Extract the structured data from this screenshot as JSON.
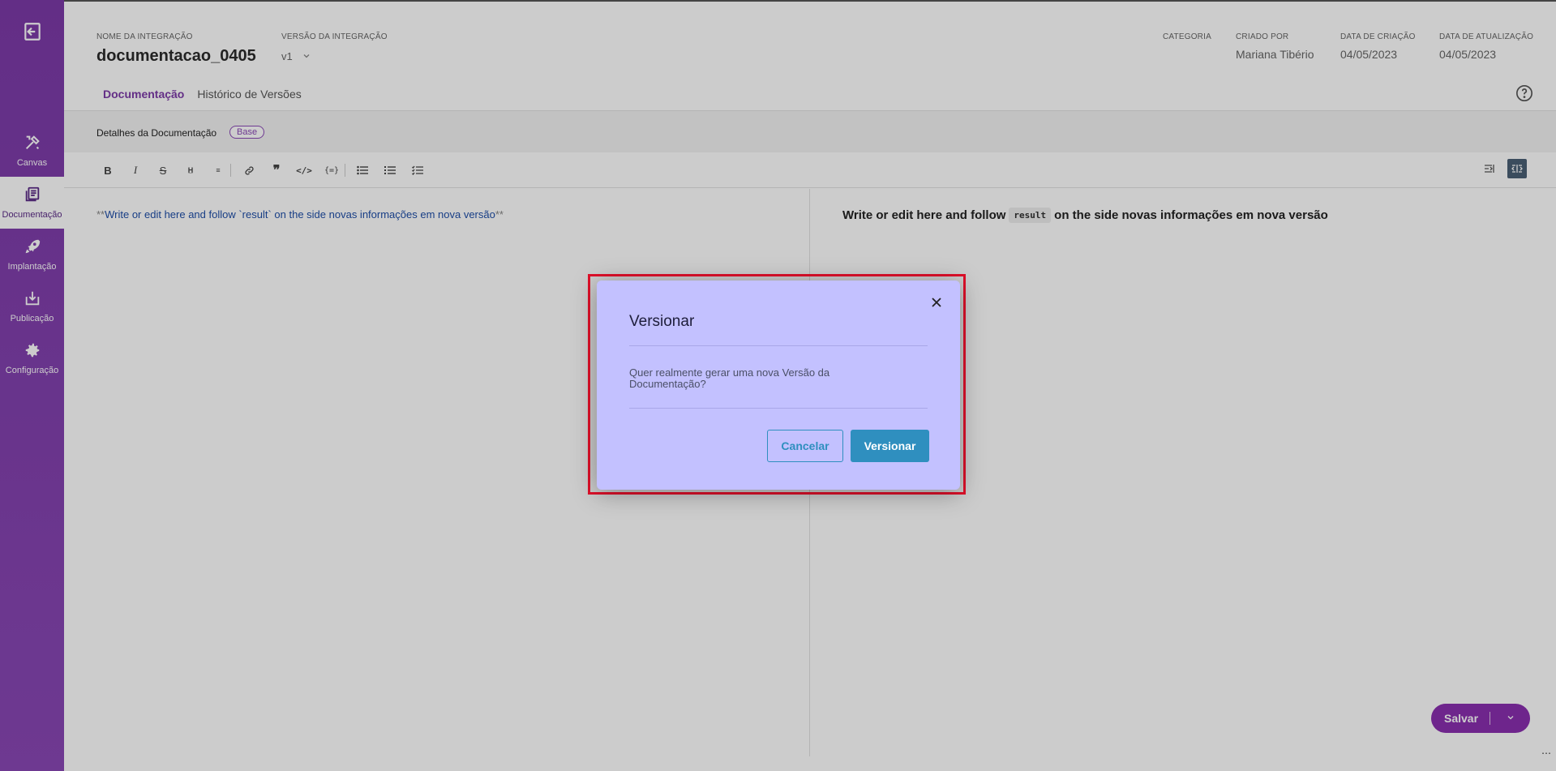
{
  "sidebar": {
    "items": [
      {
        "label": "Canvas",
        "icon": "tools-icon"
      },
      {
        "label": "Documentação",
        "icon": "document-stack-icon",
        "active": true
      },
      {
        "label": "Implantação",
        "icon": "rocket-icon"
      },
      {
        "label": "Publicação",
        "icon": "download-box-icon"
      },
      {
        "label": "Configuração",
        "icon": "gear-icon"
      }
    ]
  },
  "header": {
    "name_label": "NOME DA INTEGRAÇÃO",
    "name_value": "documentacao_0405",
    "version_label": "VERSÃO DA INTEGRAÇÃO",
    "version_value": "v1",
    "category_label": "CATEGORIA",
    "created_by_label": "CRIADO POR",
    "created_by_value": "Mariana Tibério",
    "created_date_label": "DATA DE CRIAÇÃO",
    "created_date_value": "04/05/2023",
    "updated_date_label": "DATA DE ATUALIZAÇÃO",
    "updated_date_value": "04/05/2023"
  },
  "tabs": [
    {
      "label": "Documentação",
      "active": true
    },
    {
      "label": "Histórico de Versões",
      "active": false
    }
  ],
  "section": {
    "title": "Detalhes da Documentação",
    "badge": "Base"
  },
  "editor": {
    "markdown_prefix": "**",
    "markdown_text": "Write or edit here and follow `result` on the side novas informações em nova versão",
    "markdown_suffix": "**",
    "preview_before": "Write or edit here and follow",
    "preview_code": "result",
    "preview_after": "on the side novas informações em nova versão"
  },
  "save": {
    "label": "Salvar"
  },
  "modal": {
    "title": "Versionar",
    "body": "Quer realmente gerar uma nova Versão da Documentação?",
    "cancel_label": "Cancelar",
    "confirm_label": "Versionar"
  },
  "colors": {
    "brand": "#7c3aa8",
    "modal_bg": "#c3c1ff",
    "button_blue": "#2f8fbf",
    "highlight_border": "#e0102a"
  }
}
